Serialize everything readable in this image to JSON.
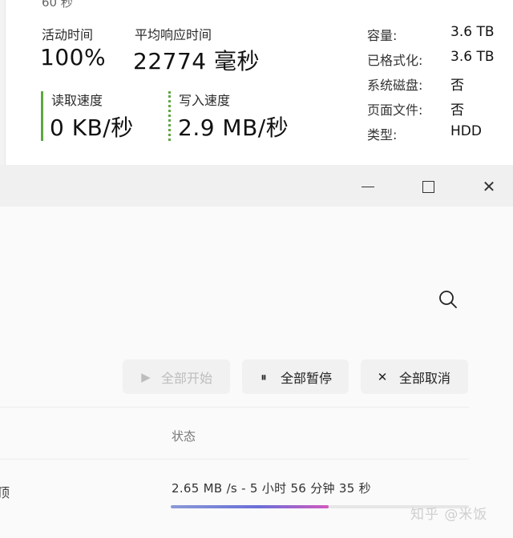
{
  "task_manager": {
    "cutoff_text": "60 秒",
    "active_time": {
      "label": "活动时间",
      "value": "100%"
    },
    "avg_response": {
      "label": "平均响应时间",
      "value": "22774 毫秒"
    },
    "read_speed": {
      "label": "读取速度",
      "value": "0 KB/秒"
    },
    "write_speed": {
      "label": "写入速度",
      "value": "2.9 MB/秒"
    },
    "properties": [
      {
        "key": "容量:",
        "value": "3.6 TB"
      },
      {
        "key": "已格式化:",
        "value": "3.6 TB"
      },
      {
        "key": "系统磁盘:",
        "value": "否"
      },
      {
        "key": "页面文件:",
        "value": "否"
      },
      {
        "key": "类型:",
        "value": "HDD"
      }
    ],
    "graph_color": "#5ea742"
  },
  "download_window": {
    "controls": {
      "close_glyph": "✕"
    },
    "toolbar": {
      "start_all": {
        "icon": "play-icon",
        "glyph": "▶",
        "label": "全部开始"
      },
      "pause_all": {
        "icon": "pause-icon",
        "glyph": "⏸",
        "label": "全部暂停"
      },
      "cancel_all": {
        "icon": "close-icon",
        "glyph": "✕",
        "label": "全部取消"
      }
    },
    "columns": {
      "status": "状态"
    },
    "row": {
      "edge_text": "顶",
      "status": "2.65 MB /s - 5 小时 56 分钟 35 秒",
      "progress": 0.53
    }
  },
  "watermark": "知乎 @米饭"
}
